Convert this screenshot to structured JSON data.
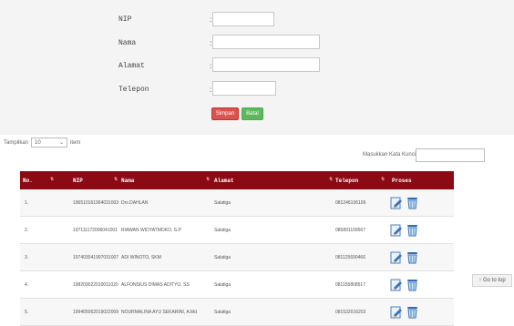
{
  "form": {
    "fields": [
      {
        "label": "NIP",
        "colon": ":",
        "value": ""
      },
      {
        "label": "Nama",
        "colon": ":",
        "value": ""
      },
      {
        "label": "Alamat",
        "colon": ":",
        "value": ""
      },
      {
        "label": "Telepon",
        "colon": ":",
        "value": ""
      }
    ],
    "save_label": "Simpan",
    "cancel_label": "Batal"
  },
  "entries": {
    "prefix": "Tampilkan",
    "selected": "10",
    "suffix": "item"
  },
  "search": {
    "label": "Masukkan Kata Kunci:",
    "value": ""
  },
  "table": {
    "columns": [
      "No.",
      "NIP",
      "Nama",
      "Alamat",
      "Telepon",
      "Proses"
    ],
    "rows": [
      {
        "no": "1.",
        "nip": "196510161994031003",
        "nama": "Drs.DAHLAN",
        "alamat": "Salatiga",
        "telepon": "081246106106"
      },
      {
        "no": "2.",
        "nip": "197111172006041001",
        "nama": "RIAWAN WIDYATMOKO, S.P",
        "alamat": "Salatiga",
        "telepon": "085891109567"
      },
      {
        "no": "3.",
        "nip": "197403041997031007",
        "nama": "ADI WINOTO, SKM",
        "alamat": "Salatiga",
        "telepon": "081125690466"
      },
      {
        "no": "4.",
        "nip": "198209022010011020",
        "nama": "ALFONSIUS DIMAS ADITYO, SS",
        "alamat": "Salatiga",
        "telepon": "081155808517"
      },
      {
        "no": "5.",
        "nip": "199405062019022009",
        "nama": "NOURMALINA AYU SEKARINI, A.Md",
        "alamat": "Salatiga",
        "telepon": "081532016202"
      }
    ]
  },
  "go_to_top": "↑ Go to top",
  "colors": {
    "header": "#8b0a14",
    "save": "#d9534f",
    "cancel": "#5cb85c"
  }
}
